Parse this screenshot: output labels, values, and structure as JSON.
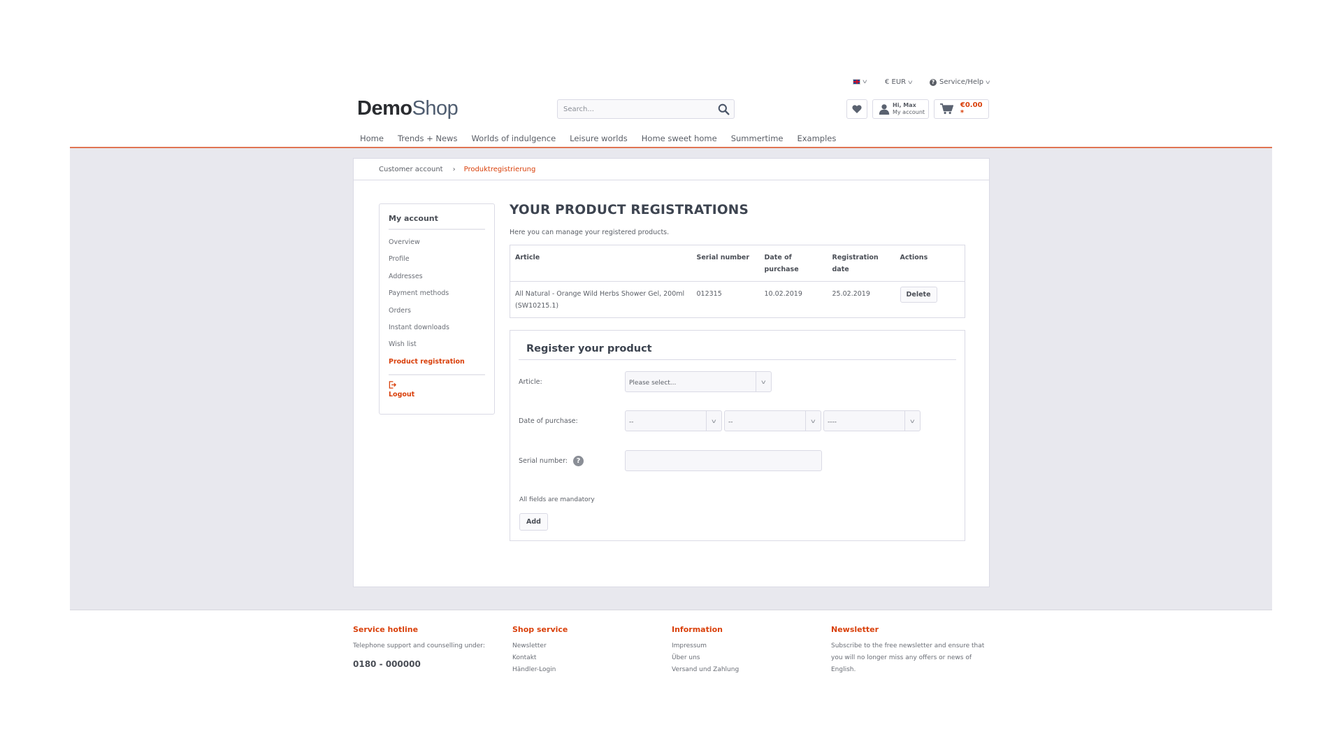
{
  "header": {
    "language": {
      "icon": "uk-flag-icon",
      "label": ""
    },
    "currency": {
      "label": "€ EUR"
    },
    "service": {
      "label": "Service/Help"
    },
    "logo": {
      "bold": "Demo",
      "light": "Shop"
    },
    "search": {
      "placeholder": "Search...",
      "value": ""
    },
    "account": {
      "greeting": "Hi, Max",
      "label": "My account"
    },
    "cart": {
      "amount": "€0.00 *"
    }
  },
  "nav": {
    "items": [
      "Home",
      "Trends + News",
      "Worlds of indulgence",
      "Leisure worlds",
      "Home sweet home",
      "Summertime",
      "Examples"
    ]
  },
  "breadcrumb": {
    "items": [
      "Customer account",
      "Produktregistrierung"
    ]
  },
  "sidebar": {
    "title": "My account",
    "items": [
      {
        "label": "Overview"
      },
      {
        "label": "Profile"
      },
      {
        "label": "Addresses"
      },
      {
        "label": "Payment methods"
      },
      {
        "label": "Orders"
      },
      {
        "label": "Instant downloads"
      },
      {
        "label": "Wish list"
      },
      {
        "label": "Product registration",
        "active": true
      }
    ],
    "logout": "Logout"
  },
  "main": {
    "title": "YOUR PRODUCT REGISTRATIONS",
    "intro": "Here you can manage your registered products.",
    "table": {
      "headers": [
        "Article",
        "Serial number",
        "Date of purchase",
        "Registration date",
        "Actions"
      ],
      "rows": [
        {
          "article": "All Natural - Orange Wild Herbs Shower Gel, 200ml (SW10215.1)",
          "serial": "012315",
          "purchase_date": "10.02.2019",
          "registration_date": "25.02.2019",
          "action": "Delete"
        }
      ]
    },
    "form": {
      "title": "Register your product",
      "article_label": "Article:",
      "article_select": "Please select...",
      "date_label": "Date of purchase:",
      "day_select": "--",
      "month_select": "--",
      "year_select": "----",
      "serial_label": "Serial number:",
      "serial_value": "",
      "mandatory_note": "All fields are mandatory",
      "add_label": "Add"
    }
  },
  "footer": {
    "hotline": {
      "title": "Service hotline",
      "text": "Telephone support and counselling under:",
      "phone": "0180 - 000000"
    },
    "shop_service": {
      "title": "Shop service",
      "links": [
        "Newsletter",
        "Kontakt",
        "Händler-Login"
      ]
    },
    "information": {
      "title": "Information",
      "links": [
        "Impressum",
        "Über uns",
        "Versand und Zahlung"
      ]
    },
    "newsletter": {
      "title": "Newsletter",
      "text": "Subscribe to the free newsletter and ensure that you will no longer miss any offers or news of English."
    }
  },
  "colors": {
    "accent": "#d9400b",
    "band": "#e8e8ee",
    "border": "#dadae5",
    "rule": "#e07553"
  }
}
